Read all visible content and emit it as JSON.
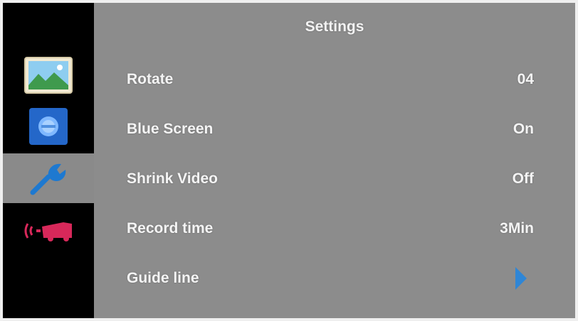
{
  "header": {
    "title": "Settings"
  },
  "sidebar": {
    "items": [
      {
        "id": "picture",
        "icon": "landscape-picture-icon",
        "active": false
      },
      {
        "id": "display",
        "icon": "blue-circle-icon",
        "active": false
      },
      {
        "id": "settings",
        "icon": "wrench-icon",
        "active": true
      },
      {
        "id": "reverse-camera",
        "icon": "car-reverse-sensor-icon",
        "active": false
      }
    ]
  },
  "settings": {
    "items": [
      {
        "label": "Rotate",
        "value": "04"
      },
      {
        "label": "Blue Screen",
        "value": "On"
      },
      {
        "label": "Shrink Video",
        "value": "Off"
      },
      {
        "label": "Record time",
        "value": "3Min"
      },
      {
        "label": "Guide line",
        "value": "",
        "icon": "play-arrow-icon"
      }
    ]
  },
  "colors": {
    "sidebar_bg": "#000000",
    "sidebar_active_bg": "#8a8a8a",
    "panel_bg": "#8c8c8c",
    "text": "#f4f4f4",
    "accent_blue": "#2f86d6",
    "accent_pink": "#d8285a"
  }
}
